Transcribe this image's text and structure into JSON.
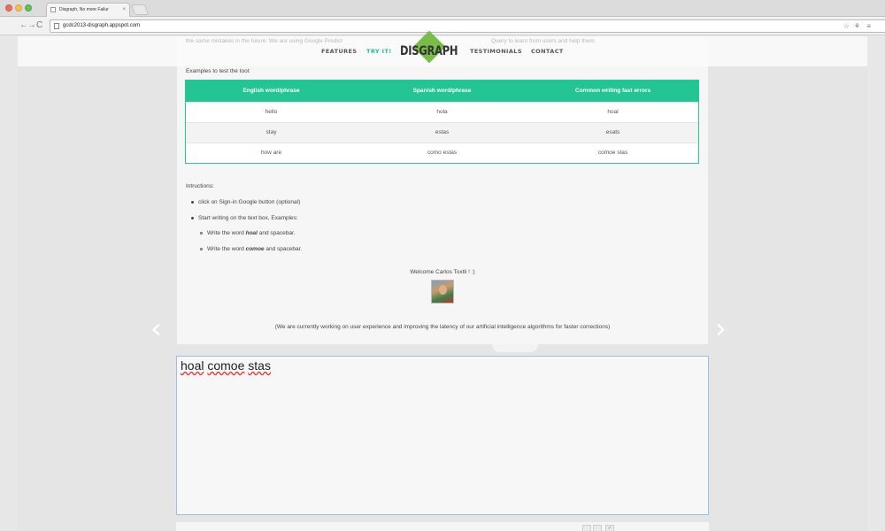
{
  "browser": {
    "tab_title": "Disgraph, No more Failur",
    "tab_close": "×",
    "url": "gcdc2013-disgraph.appspot.com",
    "back": "←",
    "forward": "→",
    "reload": "C",
    "star": "☆"
  },
  "header": {
    "behind_text_1": "the same mistakes in the future. We are using Google Predict",
    "behind_text_2": "Query to learn from users and help them.",
    "logo": "DISGRAPH",
    "nav": {
      "features": "FEATURES",
      "try_it": "TRY IT!",
      "testimonials": "TESTIMONIALS",
      "contact": "CONTACT"
    },
    "accent_color": "#1bbf92"
  },
  "examples": {
    "label": "Examples to test the tool:",
    "columns": [
      "English word/phrase",
      "Spanish word/phrase",
      "Common writing fast errors"
    ],
    "rows": [
      [
        "hello",
        "hola",
        "hoal"
      ],
      [
        "stay",
        "estas",
        "esats"
      ],
      [
        "how are",
        "como estas",
        "comoe stas"
      ]
    ],
    "header_color": "#22c593"
  },
  "instructions": {
    "label": "Intructions:",
    "items": [
      "click on Sign-in Google button (optional)",
      "Start writing on the text box, Examples:"
    ],
    "sub_items": [
      {
        "prefix": "Write the word ",
        "word": "hoal",
        "suffix": " and spacebar."
      },
      {
        "prefix": "Write the word ",
        "word": "comoe",
        "suffix": " and spacebar."
      }
    ]
  },
  "welcome": "Welcome Carlos Toxtli ! :)",
  "note": "(We are currently working on user experience and improving the latency of our artificial intelligence algorithms for faster corrections)",
  "editor": {
    "words": [
      "hoal",
      "comoe",
      "stas"
    ]
  },
  "icons": {
    "arrow_left": "‹",
    "arrow_right": "›",
    "close": "×"
  }
}
